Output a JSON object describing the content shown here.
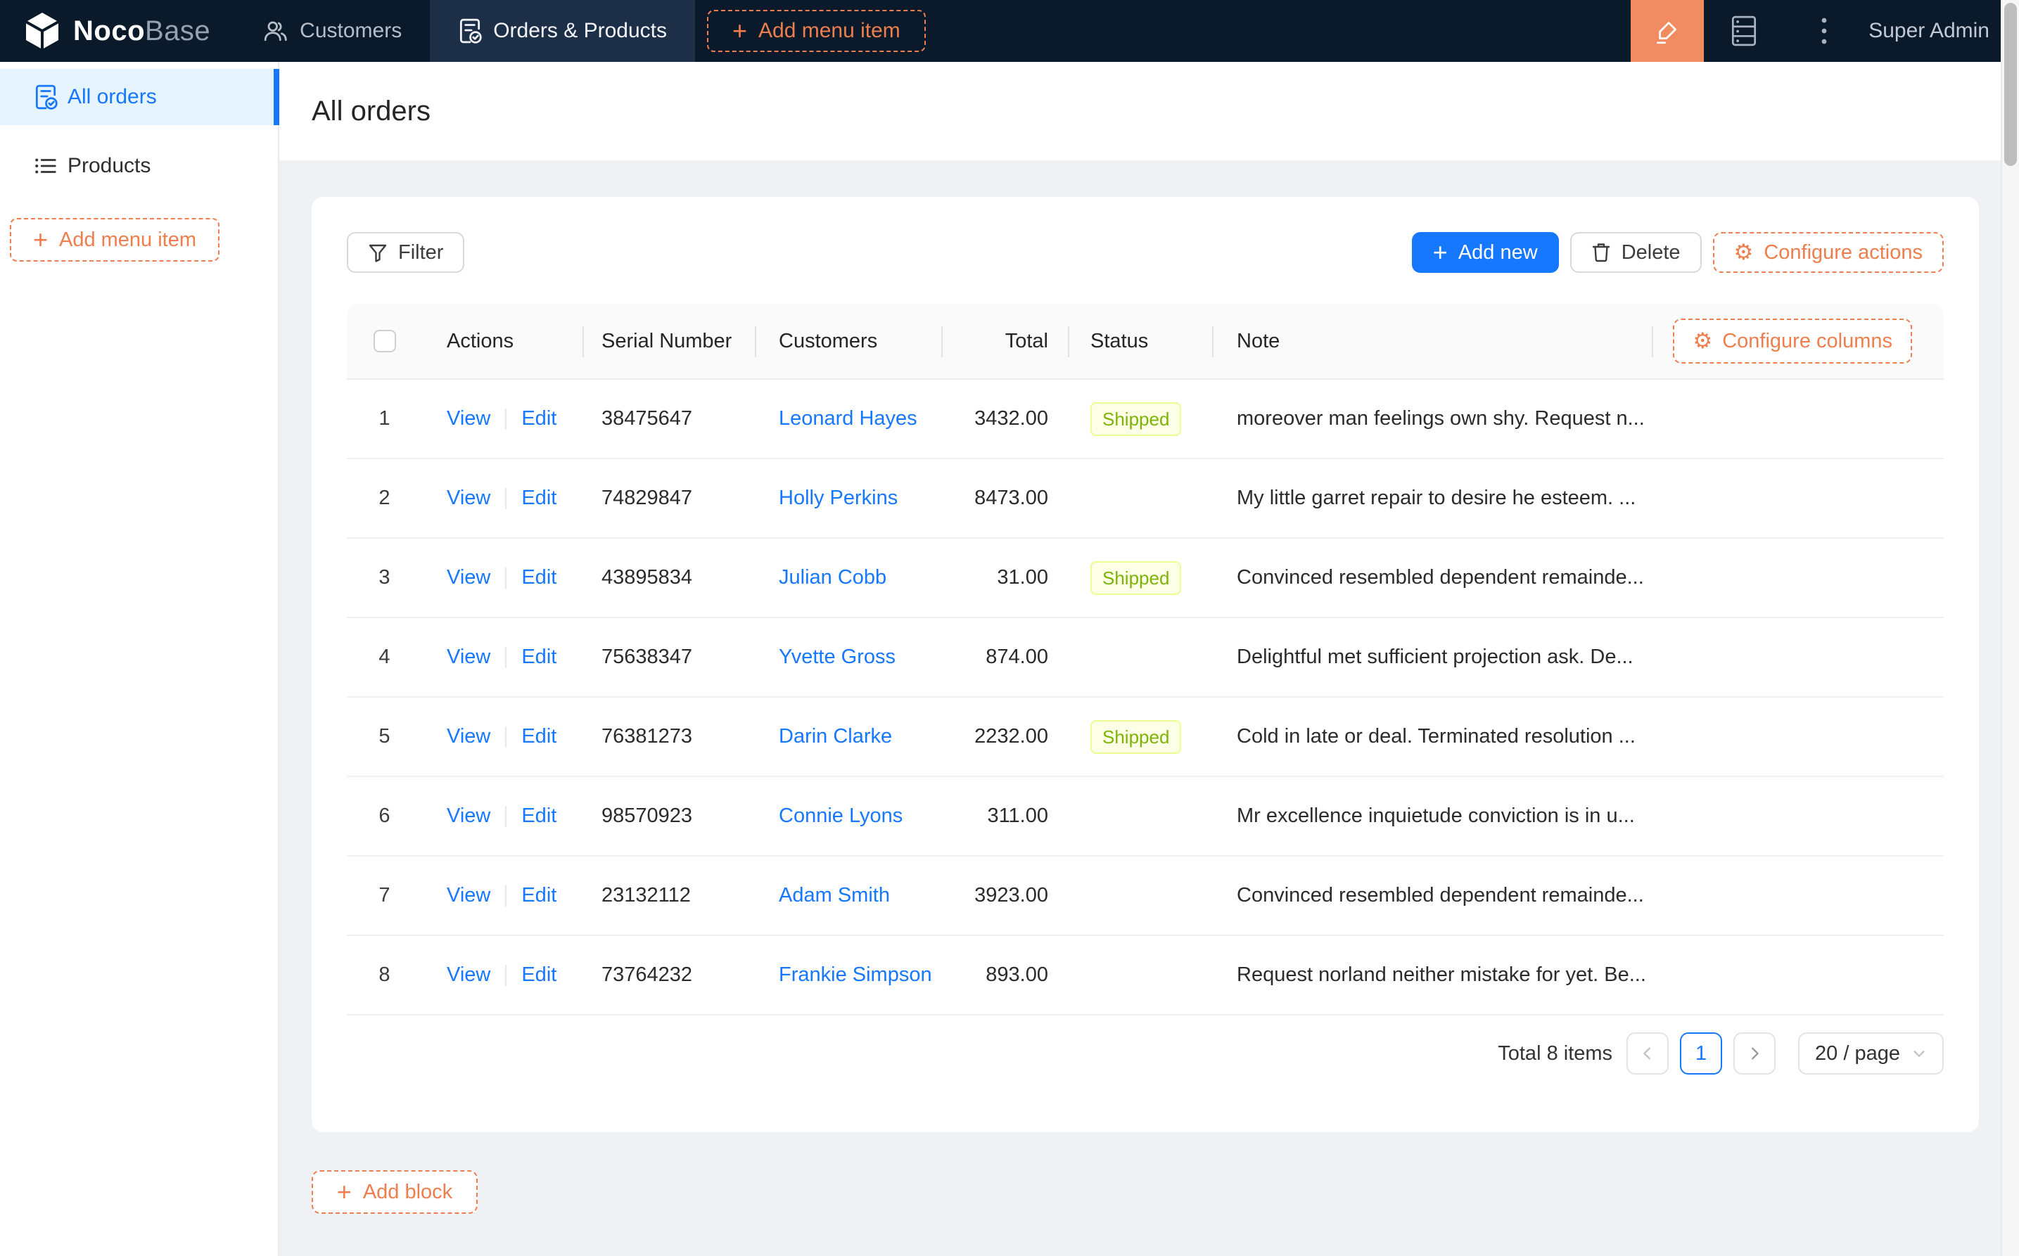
{
  "topbar": {
    "logo_noco": "Noco",
    "logo_base": "Base",
    "nav": [
      {
        "label": "Customers"
      },
      {
        "label": "Orders & Products"
      }
    ],
    "add_menu_item_label": "Add menu item",
    "user": "Super Admin"
  },
  "sidebar": {
    "items": [
      {
        "label": "All orders"
      },
      {
        "label": "Products"
      }
    ],
    "add_menu_item_label": "Add menu item"
  },
  "page": {
    "title": "All orders"
  },
  "toolbar": {
    "filter_label": "Filter",
    "add_new_label": "Add new",
    "delete_label": "Delete",
    "configure_actions_label": "Configure actions"
  },
  "table": {
    "configure_columns_label": "Configure columns",
    "columns": [
      "Actions",
      "Serial Number",
      "Customers",
      "Total",
      "Status",
      "Note"
    ],
    "action_labels": [
      "View",
      "Edit"
    ],
    "rows": [
      {
        "index": "1",
        "serial": "38475647",
        "customer": "Leonard Hayes",
        "total": "3432.00",
        "status": "Shipped",
        "note": "moreover man feelings own shy. Request n..."
      },
      {
        "index": "2",
        "serial": "74829847",
        "customer": "Holly Perkins",
        "total": "8473.00",
        "status": "",
        "note": "My little garret repair to desire he esteem. ..."
      },
      {
        "index": "3",
        "serial": "43895834",
        "customer": "Julian Cobb",
        "total": "31.00",
        "status": "Shipped",
        "note": "Convinced resembled dependent remainde..."
      },
      {
        "index": "4",
        "serial": "75638347",
        "customer": "Yvette Gross",
        "total": "874.00",
        "status": "",
        "note": "Delightful met sufficient projection ask. De..."
      },
      {
        "index": "5",
        "serial": "76381273",
        "customer": "Darin Clarke",
        "total": "2232.00",
        "status": "Shipped",
        "note": "Cold in late or deal. Terminated resolution ..."
      },
      {
        "index": "6",
        "serial": "98570923",
        "customer": "Connie Lyons",
        "total": "311.00",
        "status": "",
        "note": "Mr excellence inquietude conviction is in u..."
      },
      {
        "index": "7",
        "serial": "23132112",
        "customer": "Adam Smith",
        "total": "3923.00",
        "status": "",
        "note": "Convinced resembled dependent remainde..."
      },
      {
        "index": "8",
        "serial": "73764232",
        "customer": "Frankie Simpson",
        "total": "893.00",
        "status": "",
        "note": "Request norland neither mistake for yet. Be..."
      }
    ]
  },
  "pagination": {
    "total_text": "Total 8 items",
    "current_page": "1",
    "page_size": "20 / page"
  },
  "footer": {
    "add_block_label": "Add block"
  },
  "icons": {
    "plus_glyph": "+",
    "gear_glyph": "⚙"
  },
  "colors": {
    "navy": "#0b1a2b",
    "navy_active": "#1d2e47",
    "orange": "#ee7e4d",
    "orange_bright": "#f18b62",
    "blue": "#1677ff",
    "lime_bg": "#fcffe6",
    "lime_border": "#eaff8f",
    "lime_text": "#7cb305",
    "sidebar_active_bg": "#e6f4ff",
    "page_bg": "#f0f1f4"
  }
}
